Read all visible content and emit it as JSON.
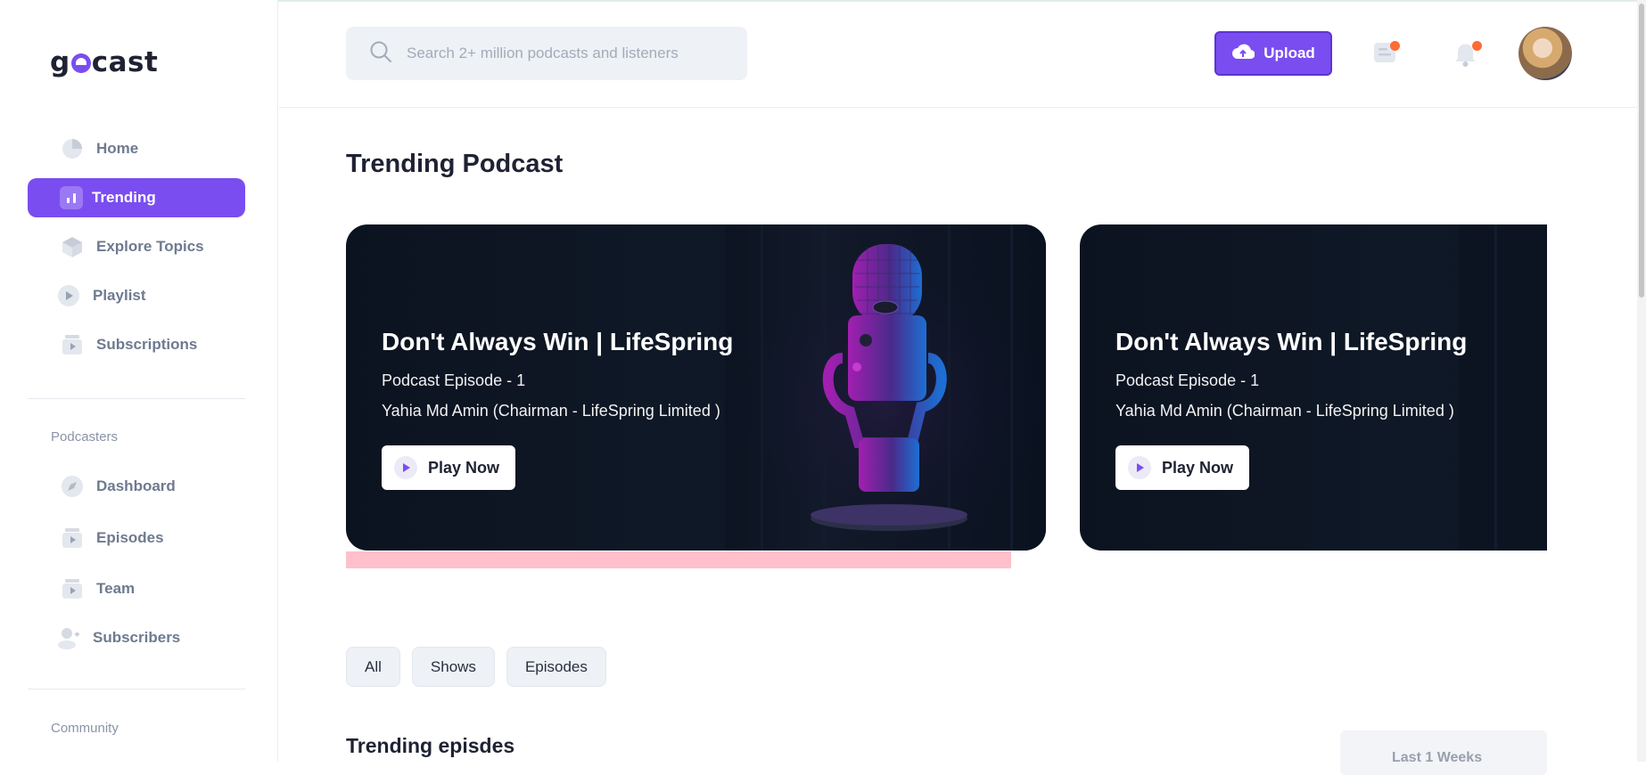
{
  "app": {
    "logo_text": "gocast"
  },
  "sidebar": {
    "main_items": [
      {
        "label": "Home",
        "icon": "pie-chart-icon"
      },
      {
        "label": "Trending",
        "icon": "bar-chart-icon",
        "active": true
      },
      {
        "label": "Explore Topics",
        "icon": "cube-icon"
      },
      {
        "label": "Playlist",
        "icon": "play-circle-icon"
      },
      {
        "label": "Subscriptions",
        "icon": "subscription-icon"
      }
    ],
    "podcasters_title": "Podcasters",
    "podcaster_items": [
      {
        "label": "Dashboard",
        "icon": "compass-icon"
      },
      {
        "label": "Episodes",
        "icon": "episodes-icon"
      },
      {
        "label": "Team",
        "icon": "team-icon"
      },
      {
        "label": "Subscribers",
        "icon": "user-add-icon"
      }
    ],
    "community_title": "Community"
  },
  "header": {
    "search_placeholder": "Search 2+ million podcasts and listeners",
    "upload_label": "Upload",
    "accent": "#7a4df0",
    "notification_dot_color": "#ff6b35"
  },
  "main": {
    "title": "Trending Podcast",
    "cards": [
      {
        "title": "Don't Always Win | LifeSpring",
        "subtitle": "Podcast Episode - 1",
        "author": "Yahia Md Amin (Chairman - LifeSpring Limited )",
        "button": "Play Now"
      },
      {
        "title": "Don't Always Win | LifeSpring",
        "subtitle": "Podcast Episode - 1",
        "author": "Yahia Md Amin (Chairman - LifeSpring Limited )",
        "button": "Play Now"
      }
    ],
    "filters": [
      "All",
      "Shows",
      "Episodes"
    ],
    "section_title": "Trending episdes",
    "period_label": "Last 1 Weeks"
  }
}
